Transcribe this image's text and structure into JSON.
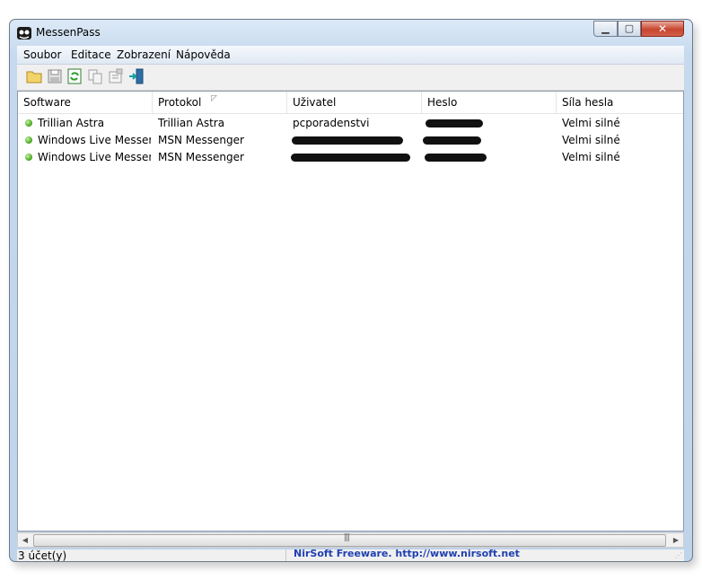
{
  "window": {
    "title": "MessenPass"
  },
  "menu": [
    "Soubor",
    "Editace",
    "Zobrazení",
    "Nápověda"
  ],
  "toolbar": {
    "icons": [
      "open-folder-icon",
      "save-icon",
      "refresh-icon",
      "copy-icon",
      "properties-icon",
      "exit-icon"
    ]
  },
  "columns": [
    "Software",
    "Protokol",
    "Uživatel",
    "Heslo",
    "Síla hesla"
  ],
  "rows": [
    {
      "software": "Trillian Astra",
      "protokol": "Trillian Astra",
      "uzivatel": "pcporadenstvi",
      "heslo": "",
      "sila": "Velmi silné"
    },
    {
      "software": "Windows Live Messen...",
      "protokol": "MSN Messenger",
      "uzivatel": "",
      "heslo": "",
      "sila": "Velmi silné"
    },
    {
      "software": "Windows Live Messen...",
      "protokol": "MSN Messenger",
      "uzivatel": "",
      "heslo": "",
      "sila": "Velmi silné"
    }
  ],
  "status": {
    "count": "3 účet(y)",
    "link": "NirSoft Freeware.  http://www.nirsoft.net"
  },
  "colors": {
    "status_link": "#1f3fb0",
    "status_dot": "#3fa316"
  }
}
